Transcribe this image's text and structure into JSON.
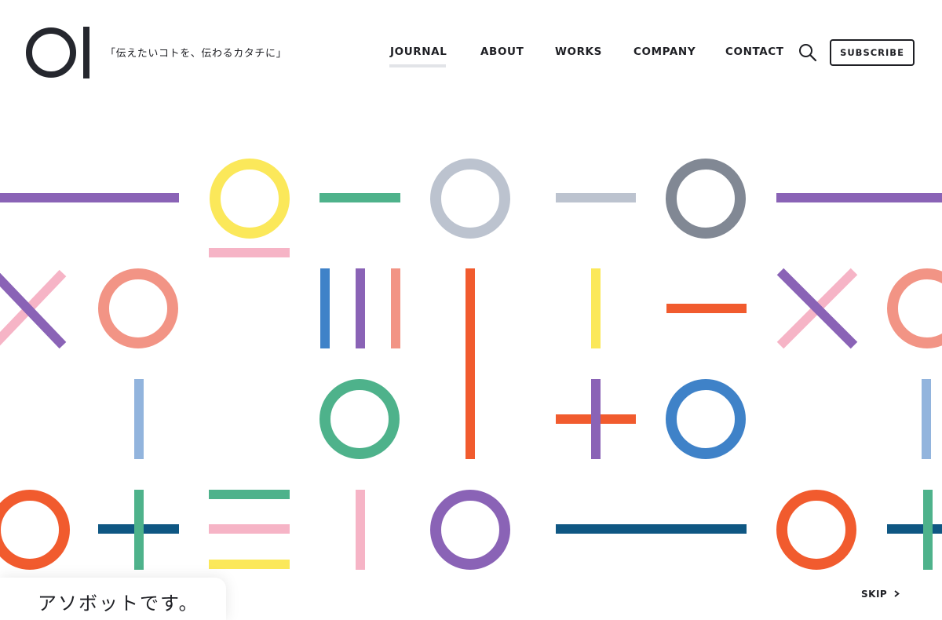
{
  "brand": {
    "logo_text": "OI",
    "tagline": "「伝えたいコトを、伝わるカタチに」"
  },
  "nav": {
    "items": [
      {
        "label": "JOURNAL",
        "active": true
      },
      {
        "label": "ABOUT",
        "active": false
      },
      {
        "label": "WORKS",
        "active": false
      },
      {
        "label": "COMPANY",
        "active": false
      },
      {
        "label": "CONTACT",
        "active": false
      }
    ],
    "search_icon": "search-icon",
    "subscribe_label": "SUBSCRIBE"
  },
  "hero": {
    "caption": "アソボットです。",
    "skip_label": "SKIP",
    "skip_icon": "chevron-right-icon"
  },
  "colors": {
    "ink": "#1e1f24",
    "purple": "#8a63b6",
    "yellow": "#fbe85a",
    "green": "#4eb28b",
    "gray_light": "#bcc3cf",
    "gray_dark": "#818894",
    "pink": "#f6b4c6",
    "salmon": "#f29485",
    "blue": "#3f82c8",
    "orange": "#f15b2e",
    "light_blue": "#92b4dd",
    "navy": "#0f5783"
  }
}
